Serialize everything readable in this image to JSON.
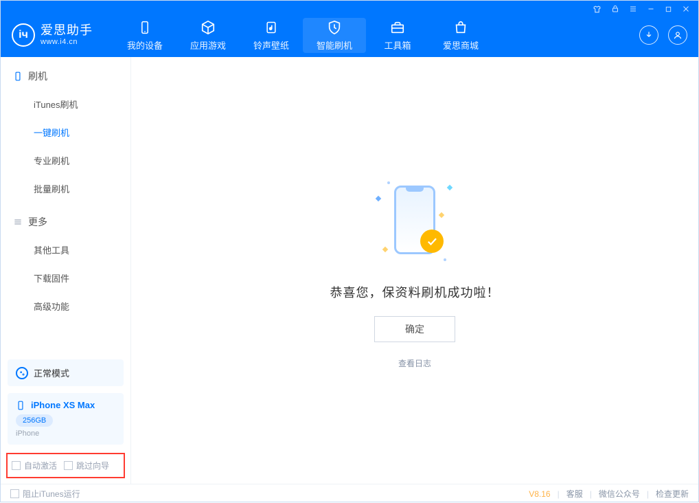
{
  "brand": {
    "title": "爱思助手",
    "subtitle": "www.i4.cn"
  },
  "tabs": [
    {
      "label": "我的设备"
    },
    {
      "label": "应用游戏"
    },
    {
      "label": "铃声壁纸"
    },
    {
      "label": "智能刷机"
    },
    {
      "label": "工具箱"
    },
    {
      "label": "爱思商城"
    }
  ],
  "sidebar": {
    "group1": {
      "title": "刷机",
      "items": [
        "iTunes刷机",
        "一键刷机",
        "专业刷机",
        "批量刷机"
      ]
    },
    "group2": {
      "title": "更多",
      "items": [
        "其他工具",
        "下载固件",
        "高级功能"
      ]
    }
  },
  "mode": {
    "label": "正常模式"
  },
  "device": {
    "name": "iPhone XS Max",
    "storage": "256GB",
    "type": "iPhone"
  },
  "options": {
    "auto_activate": "自动激活",
    "skip_guide": "跳过向导"
  },
  "main": {
    "success": "恭喜您，保资料刷机成功啦！",
    "ok": "确定",
    "view_log": "查看日志"
  },
  "footer": {
    "block_itunes": "阻止iTunes运行",
    "version": "V8.16",
    "support": "客服",
    "wechat": "微信公众号",
    "update": "检查更新"
  }
}
